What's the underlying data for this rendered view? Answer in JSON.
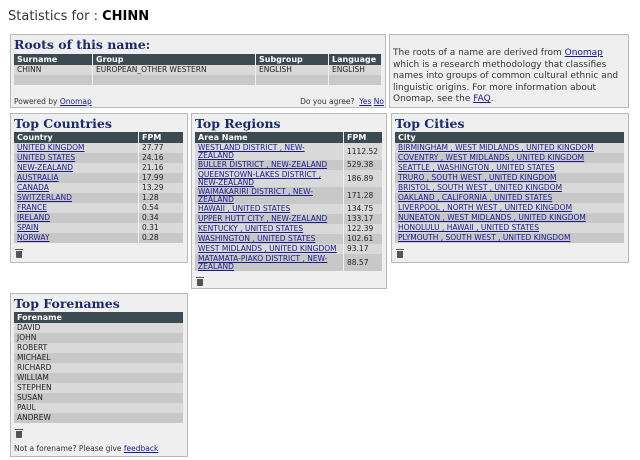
{
  "header": {
    "prefix": "Statistics for :",
    "name": "CHINN"
  },
  "roots": {
    "title": "Roots of this name:",
    "columns": [
      "Surname",
      "Group",
      "Subgroup",
      "Language"
    ],
    "row": [
      "CHINN",
      "EUROPEAN_OTHER WESTERN",
      "ENGLISH",
      "ENGLISH"
    ],
    "powered_by": "Powered by",
    "onomap_link": "Onomap",
    "agree_question": "Do you agree?",
    "yes": "Yes",
    "no": "No"
  },
  "info": {
    "text_before": "The roots of a name are derived from ",
    "onomap_link": "Onomap",
    "text_middle": " which is a research methodology that classifies names into groups of common cultural ethnic and linguistic origins. For more information about Onomap, see the ",
    "faq_link": "FAQ",
    "text_after": "."
  },
  "countries": {
    "title": "Top Countries",
    "col_country": "Country",
    "col_fpm": "FPM",
    "rows": [
      {
        "name": "UNITED KINGDOM",
        "fpm": "27.77"
      },
      {
        "name": "UNITED STATES",
        "fpm": "24.16"
      },
      {
        "name": "NEW-ZEALAND",
        "fpm": "21.16"
      },
      {
        "name": "AUSTRALIA",
        "fpm": "17.99"
      },
      {
        "name": "CANADA",
        "fpm": "13.29"
      },
      {
        "name": "SWITZERLAND",
        "fpm": "1.28"
      },
      {
        "name": "FRANCE",
        "fpm": "0.54"
      },
      {
        "name": "IRELAND",
        "fpm": "0.34"
      },
      {
        "name": "SPAIN",
        "fpm": "0.31"
      },
      {
        "name": "NORWAY",
        "fpm": "0.28"
      }
    ]
  },
  "regions": {
    "title": "Top Regions",
    "col_area": "Area Name",
    "col_fpm": "FPM",
    "rows": [
      {
        "name": "WESTLAND DISTRICT , NEW-ZEALAND",
        "fpm": "1112.52"
      },
      {
        "name": "BULLER DISTRICT , NEW-ZEALAND",
        "fpm": "529.38"
      },
      {
        "name": "QUEENSTOWN-LAKES DISTRICT , NEW-ZEALAND",
        "fpm": "186.89"
      },
      {
        "name": "WAIMAKARIRI DISTRICT , NEW-ZEALAND",
        "fpm": "171.28"
      },
      {
        "name": "HAWAII , UNITED STATES",
        "fpm": "134.75"
      },
      {
        "name": "UPPER HUTT CITY , NEW-ZEALAND",
        "fpm": "133.17"
      },
      {
        "name": "KENTUCKY , UNITED STATES",
        "fpm": "122.39"
      },
      {
        "name": "WASHINGTON , UNITED STATES",
        "fpm": "102.61"
      },
      {
        "name": "WEST MIDLANDS , UNITED KINGDOM",
        "fpm": "93.17"
      },
      {
        "name": "MATAMATA-PIAKO DISTRICT , NEW-ZEALAND",
        "fpm": "88.57"
      }
    ]
  },
  "cities": {
    "title": "Top Cities",
    "col_city": "City",
    "rows": [
      "BIRMINGHAM , WEST MIDLANDS , UNITED KINGDOM",
      "COVENTRY , WEST MIDLANDS , UNITED KINGDOM",
      "SEATTLE , WASHINGTON , UNITED STATES",
      "TRURO , SOUTH WEST , UNITED KINGDOM",
      "BRISTOL , SOUTH WEST , UNITED KINGDOM",
      "OAKLAND , CALIFORNIA , UNITED STATES",
      "LIVERPOOL , NORTH WEST , UNITED KINGDOM",
      "NUNEATON , WEST MIDLANDS , UNITED KINGDOM",
      "HONOLULU , HAWAII , UNITED STATES",
      "PLYMOUTH , SOUTH WEST , UNITED KINGDOM"
    ]
  },
  "forenames": {
    "title": "Top Forenames",
    "col_forename": "Forename",
    "rows": [
      "DAVID",
      "JOHN",
      "ROBERT",
      "MICHAEL",
      "RICHARD",
      "WILLIAM",
      "STEPHEN",
      "SUSAN",
      "PAUL",
      "ANDREW"
    ],
    "feedback_text": "Not a forename? Please give ",
    "feedback_link": "feedback"
  }
}
